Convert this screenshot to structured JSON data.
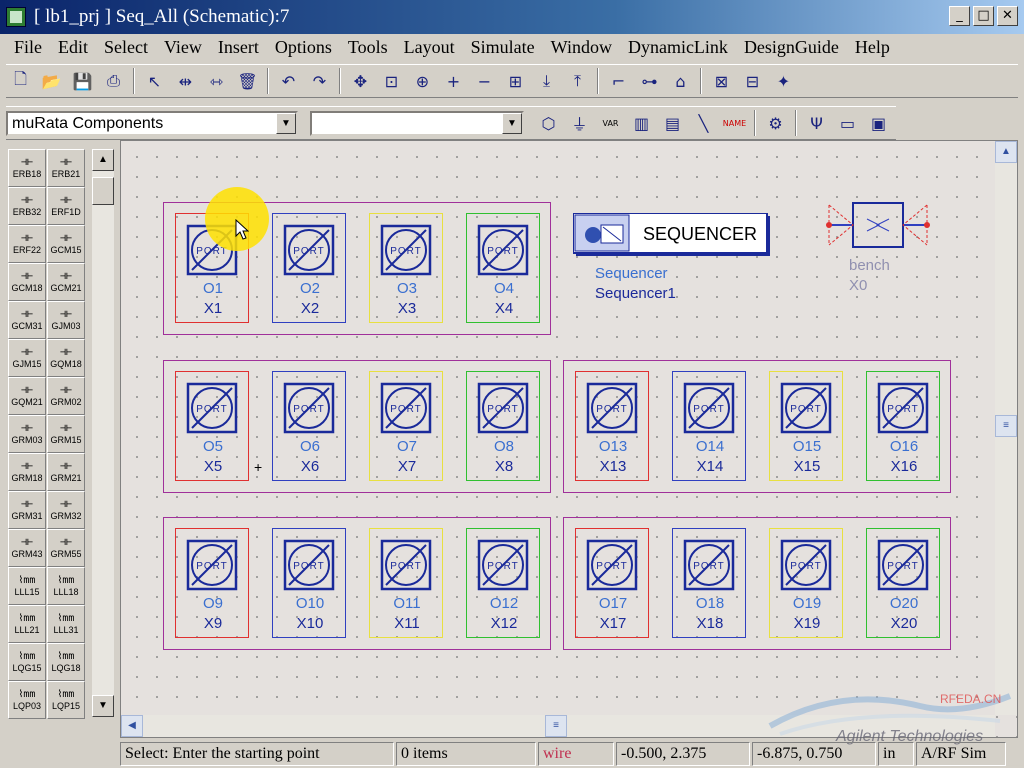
{
  "window": {
    "title": "[ lb1_prj ] Seq_All (Schematic):7",
    "minimize": "_",
    "maximize": "□",
    "close": "✕"
  },
  "menu": [
    "File",
    "Edit",
    "Select",
    "View",
    "Insert",
    "Options",
    "Tools",
    "Layout",
    "Simulate",
    "Window",
    "DynamicLink",
    "DesignGuide",
    "Help"
  ],
  "toolbar1_icons": [
    "new-icon",
    "open-icon",
    "save-icon",
    "print-icon",
    "select-arrow-icon",
    "mirror-x-icon",
    "mirror-y-icon",
    "delete-icon",
    "undo-icon",
    "redo-icon",
    "move-icon",
    "zoom-area-icon",
    "zoom-in-icon",
    "zoom-plus-icon",
    "zoom-minus-icon",
    "zoom-fit-icon",
    "push-down-icon",
    "pop-up-icon",
    "wire-icon",
    "name-icon",
    "pin-icon",
    "deactivate-icon",
    "short-icon",
    "wand-icon"
  ],
  "toolbar2": {
    "library": "muRata Components",
    "component": "",
    "var_label": "VAR",
    "name_label": "NAME"
  },
  "palette": [
    "ERB18",
    "ERB21",
    "ERB32",
    "ERF1D",
    "ERF22",
    "GCM15",
    "GCM18",
    "GCM21",
    "GCM31",
    "GJM03",
    "GJM15",
    "GQM18",
    "GQM21",
    "GRM02",
    "GRM03",
    "GRM15",
    "GRM18",
    "GRM21",
    "GRM31",
    "GRM32",
    "GRM43",
    "GRM55",
    "LLL15",
    "LLL18",
    "LLL21",
    "LLL31",
    "LQG15",
    "LQG18",
    "LQP03",
    "LQP15"
  ],
  "ports": [
    {
      "o": "O1",
      "x": "X1",
      "color": "#e03030"
    },
    {
      "o": "O2",
      "x": "X2",
      "color": "#3040c0"
    },
    {
      "o": "O3",
      "x": "X3",
      "color": "#e8e040"
    },
    {
      "o": "O4",
      "x": "X4",
      "color": "#30c030"
    },
    {
      "o": "O5",
      "x": "X5",
      "color": "#e03030"
    },
    {
      "o": "O6",
      "x": "X6",
      "color": "#3040c0"
    },
    {
      "o": "O7",
      "x": "X7",
      "color": "#e8e040"
    },
    {
      "o": "O8",
      "x": "X8",
      "color": "#30c030"
    },
    {
      "o": "O9",
      "x": "X9",
      "color": "#e03030"
    },
    {
      "o": "O10",
      "x": "X10",
      "color": "#3040c0"
    },
    {
      "o": "O11",
      "x": "X11",
      "color": "#e8e040"
    },
    {
      "o": "O12",
      "x": "X12",
      "color": "#30c030"
    },
    {
      "o": "O13",
      "x": "X13",
      "color": "#e03030"
    },
    {
      "o": "O14",
      "x": "X14",
      "color": "#3040c0"
    },
    {
      "o": "O15",
      "x": "X15",
      "color": "#e8e040"
    },
    {
      "o": "O16",
      "x": "X16",
      "color": "#30c030"
    },
    {
      "o": "O17",
      "x": "X17",
      "color": "#e03030"
    },
    {
      "o": "O18",
      "x": "X18",
      "color": "#3040c0"
    },
    {
      "o": "O19",
      "x": "X19",
      "color": "#e8e040"
    },
    {
      "o": "O20",
      "x": "X20",
      "color": "#30c030"
    }
  ],
  "port_text": "PORT",
  "sequencer": {
    "title": "SEQUENCER",
    "label": "Sequencer",
    "instance": "Sequencer1"
  },
  "bench": {
    "label": "bench",
    "instance": "X0"
  },
  "plus_mark": "+",
  "watermark": {
    "site": "RFEDA.CN",
    "brand": "Agilent Technologies"
  },
  "status": {
    "prompt": "Select: Enter the starting point",
    "items": "0 items",
    "mode": "wire",
    "coord1": "-0.500, 2.375",
    "coord2": "-6.875, 0.750",
    "units": "in",
    "app": "A/RF Sim"
  },
  "colors": {
    "group_border": "#a0309a",
    "o_label": "#3a6fd0",
    "x_label": "#1a2a9a",
    "mode_text": "#c03050"
  }
}
